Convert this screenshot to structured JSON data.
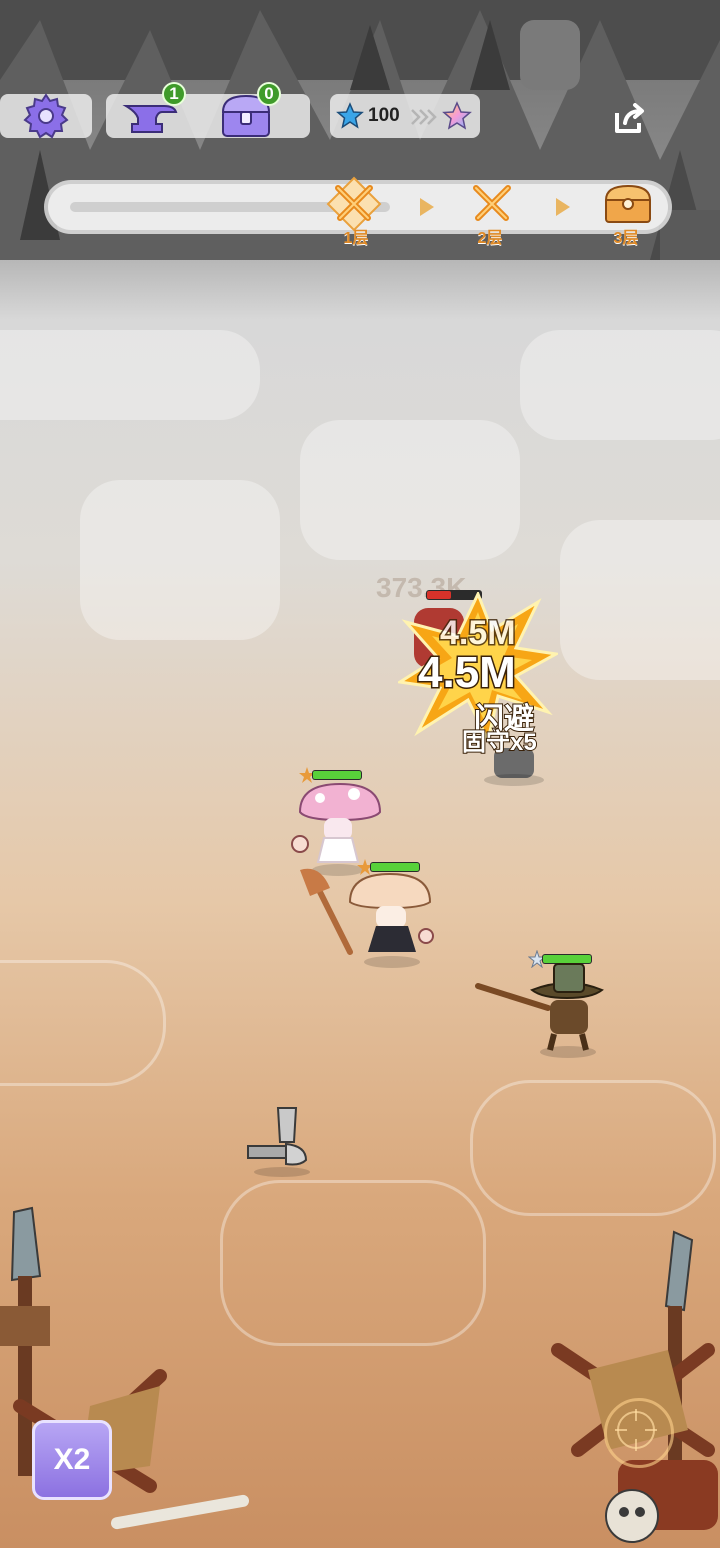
{
  "hud": {
    "anvil_count": "1",
    "chest_count": "0",
    "star_count": "100"
  },
  "progress": {
    "stages": [
      {
        "label": "1层",
        "icon": "crossed-swords-icon",
        "current": true
      },
      {
        "label": "2层",
        "icon": "crossed-swords-icon",
        "current": false
      },
      {
        "label": "3层",
        "icon": "treasure-chest-icon",
        "current": false
      }
    ]
  },
  "battle": {
    "faded_damage": "373.3K",
    "damage_small": "4.5M",
    "damage_big": "4.5M",
    "status_dodge": "闪避",
    "status_guard": "固守x5",
    "heroes": [
      {
        "name": "pink-mushroom-hero",
        "hp": 1.0
      },
      {
        "name": "cream-mushroom-hero",
        "hp": 1.0
      },
      {
        "name": "rifleman-hero",
        "hp": 1.0
      }
    ],
    "enemy_hp": 0.0
  },
  "controls": {
    "speed_label": "X2"
  },
  "colors": {
    "accent_orange": "#e08a26",
    "hp_green": "#58d13a",
    "hp_red": "#d8322a",
    "speed_purple": "#8a6fe0"
  }
}
